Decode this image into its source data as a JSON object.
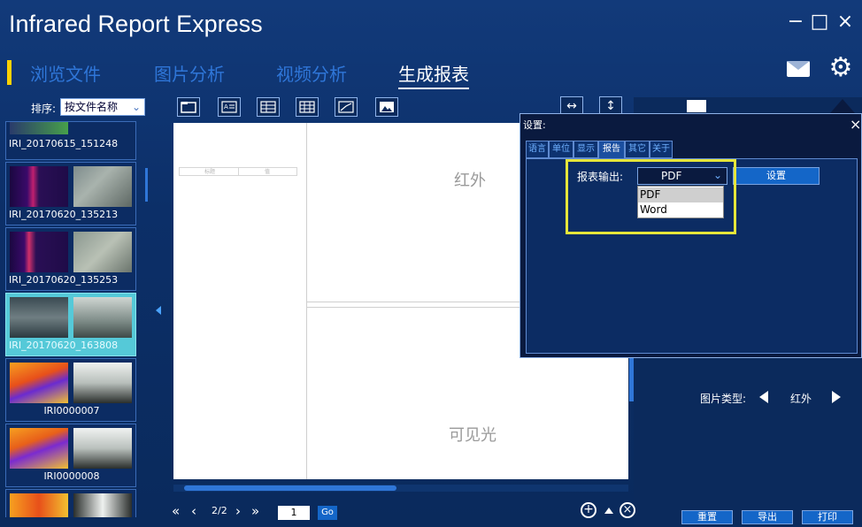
{
  "app": {
    "title": "Infrared Report Express"
  },
  "window": {
    "minimize": "−",
    "maximize": "□",
    "close": "×"
  },
  "nav": {
    "tabs": [
      {
        "label": "浏览文件",
        "active": false
      },
      {
        "label": "图片分析",
        "active": false
      },
      {
        "label": "视频分析",
        "active": false
      },
      {
        "label": "生成报表",
        "active": true
      }
    ]
  },
  "toolbar": {
    "sort_label": "排序:",
    "sort_value": "按文件名称",
    "icons": [
      "folder-icon",
      "text-block-icon",
      "table-icon",
      "grid-table-icon",
      "chart-line-icon",
      "image-icon"
    ]
  },
  "files": [
    {
      "name": "IRI_20170615_151248",
      "selected": false
    },
    {
      "name": "IRI_20170620_135213",
      "selected": false
    },
    {
      "name": "IRI_20170620_135253",
      "selected": false
    },
    {
      "name": "IRI_20170620_163808",
      "selected": true
    },
    {
      "name": "IRI0000007",
      "selected": false
    },
    {
      "name": "IRI0000008",
      "selected": false
    }
  ],
  "report_page": {
    "infrared_label": "红外",
    "visible_label": "可见光",
    "mini_table": {
      "col1": "标题",
      "col2": "值"
    }
  },
  "pager": {
    "first": "«",
    "prev": "‹",
    "info": "2/2",
    "next": "›",
    "last": "»",
    "page_input": "1",
    "go": "Go"
  },
  "zoom": {
    "in": "+",
    "out": "×"
  },
  "right_panel": {
    "image_type_label": "图片类型:",
    "image_type_value": "红外",
    "buttons": {
      "reset": "重置",
      "export": "导出",
      "print": "打印"
    }
  },
  "settings_dialog": {
    "title": "设置:",
    "close": "×",
    "tabs": [
      {
        "label": "语言",
        "active": false
      },
      {
        "label": "单位",
        "active": false
      },
      {
        "label": "显示",
        "active": false
      },
      {
        "label": "报告",
        "active": true
      },
      {
        "label": "其它",
        "active": false
      },
      {
        "label": "关于",
        "active": false
      }
    ],
    "output_label": "报表输出:",
    "output_value": "PDF",
    "output_options": [
      "PDF",
      "Word"
    ],
    "setup_button": "设置"
  },
  "colors": {
    "accent": "#ffd200",
    "nav_inactive": "#2f76d8",
    "highlight": "#e6e63a"
  }
}
